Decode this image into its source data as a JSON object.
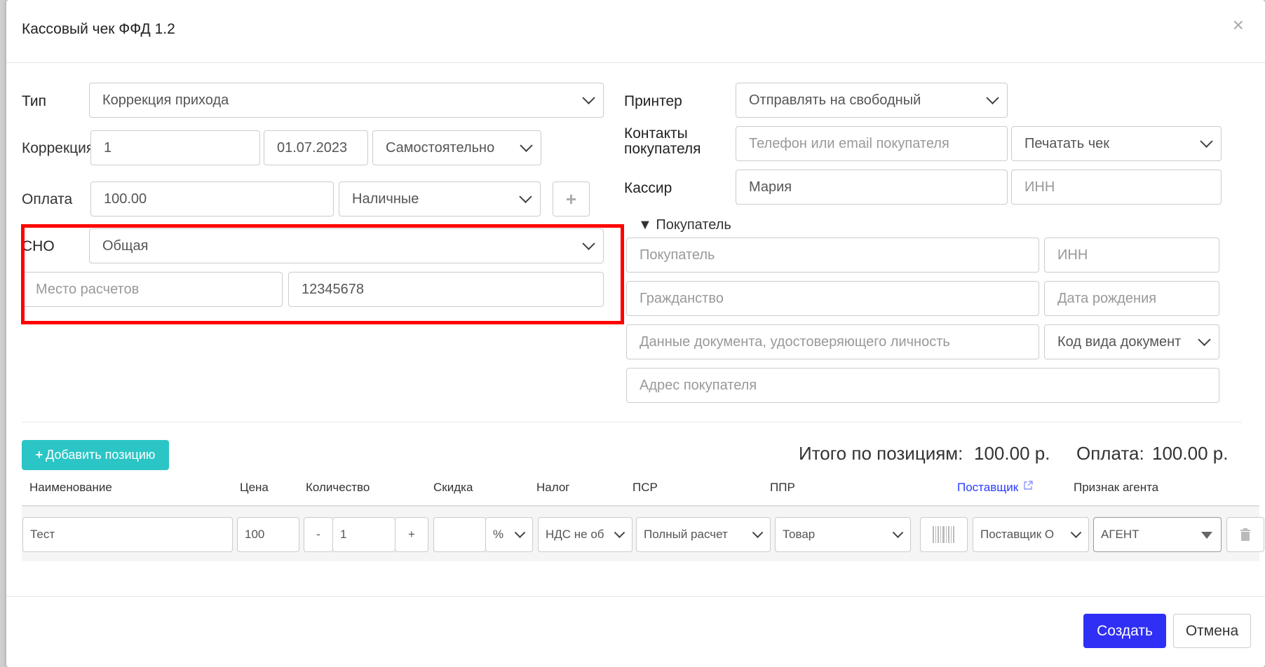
{
  "modal": {
    "title": "Кассовый чек ФФД 1.2",
    "close_glyph": "×"
  },
  "left": {
    "type_label": "Тип",
    "type_value": "Коррекция прихода",
    "correction_label": "Коррекция",
    "correction_number": "1",
    "correction_date": "01.07.2023",
    "correction_kind": "Самостоятельно",
    "payment_label": "Оплата",
    "payment_amount": "100.00",
    "payment_method": "Наличные",
    "sno_label": "СНО",
    "sno_value": "Общая",
    "settlement_place_placeholder": "Место расчетов",
    "settlement_place_code": "12345678"
  },
  "right": {
    "printer_label": "Принтер",
    "printer_value": "Отправлять на свободный",
    "contacts_label_1": "Контакты",
    "contacts_label_2": "покупателя",
    "contacts_placeholder": "Телефон или email покупателя",
    "print_option": "Печатать чек",
    "cashier_label": "Кассир",
    "cashier_value": "Мария",
    "cashier_inn_placeholder": "ИНН",
    "buyer_section": "▼ Покупатель",
    "buyer_placeholder": "Покупатель",
    "buyer_inn_placeholder": "ИНН",
    "citizenship_placeholder": "Гражданство",
    "birthdate_placeholder": "Дата рождения",
    "document_placeholder": "Данные документа, удостоверяющего личность",
    "document_code": "Код вида документ",
    "address_placeholder": "Адрес покупателя"
  },
  "items": {
    "add_button": "Добавить позицию",
    "total_label": "Итого по позициям:",
    "total_value": "100.00 р.",
    "payment_label": "Оплата:",
    "payment_value": "100.00 р.",
    "headers": {
      "name": "Наименование",
      "price": "Цена",
      "quantity": "Количество",
      "discount": "Скидка",
      "tax": "Налог",
      "psr": "ПСР",
      "ppr": "ППР",
      "supplier": "Поставщик",
      "agent": "Признак агента"
    },
    "row": {
      "name": "Тест",
      "price": "100",
      "minus": "-",
      "quantity": "1",
      "plus": "+",
      "discount": "",
      "discount_unit": "%",
      "tax": "НДС не об",
      "psr": "Полный расчет",
      "ppr": "Товар",
      "supplier": "Поставщик О",
      "agent": "АГЕНТ"
    }
  },
  "footer": {
    "create": "Создать",
    "cancel": "Отмена"
  },
  "colors": {
    "primary": "#2f2ff5",
    "accent": "#2cc5c5",
    "highlight": "#ff0000",
    "link": "#2b3cff"
  },
  "icons": [
    "close-icon",
    "chevron-down-icon",
    "plus-icon",
    "external-link-icon",
    "barcode-icon",
    "trash-icon"
  ]
}
